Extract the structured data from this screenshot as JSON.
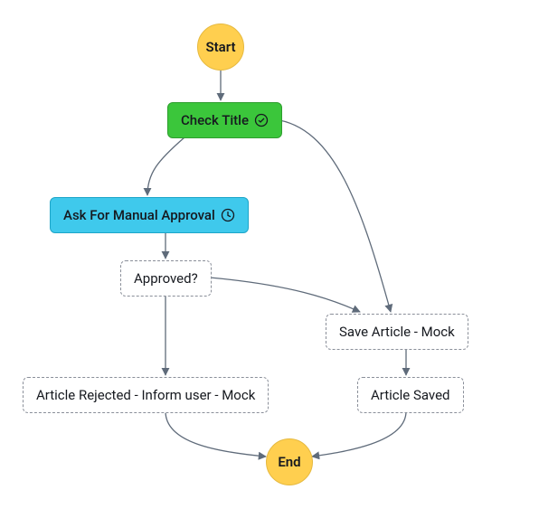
{
  "chart_data": {
    "type": "flowchart",
    "nodes": [
      {
        "id": "start",
        "label": "Start",
        "kind": "terminator"
      },
      {
        "id": "check_title",
        "label": "Check Title",
        "kind": "task",
        "status": "success",
        "icon": "check-circle"
      },
      {
        "id": "manual_approval",
        "label": "Ask For Manual Approval",
        "kind": "task",
        "status": "pending",
        "icon": "clock"
      },
      {
        "id": "approved_q",
        "label": "Approved?",
        "kind": "choice"
      },
      {
        "id": "save_article",
        "label": "Save Article - Mock",
        "kind": "task_mock"
      },
      {
        "id": "article_rejected",
        "label": "Article Rejected - Inform user - Mock",
        "kind": "task_mock"
      },
      {
        "id": "article_saved",
        "label": "Article Saved",
        "kind": "task_mock"
      },
      {
        "id": "end",
        "label": "End",
        "kind": "terminator"
      }
    ],
    "edges": [
      {
        "from": "start",
        "to": "check_title"
      },
      {
        "from": "check_title",
        "to": "manual_approval"
      },
      {
        "from": "check_title",
        "to": "save_article"
      },
      {
        "from": "manual_approval",
        "to": "approved_q"
      },
      {
        "from": "approved_q",
        "to": "article_rejected"
      },
      {
        "from": "approved_q",
        "to": "save_article"
      },
      {
        "from": "save_article",
        "to": "article_saved"
      },
      {
        "from": "article_rejected",
        "to": "end"
      },
      {
        "from": "article_saved",
        "to": "end"
      }
    ]
  },
  "colors": {
    "start_end_fill": "#ffcf4f",
    "success_fill": "#3bc63b",
    "pending_fill": "#3fc9ec",
    "edge": "#5f6b7a"
  }
}
